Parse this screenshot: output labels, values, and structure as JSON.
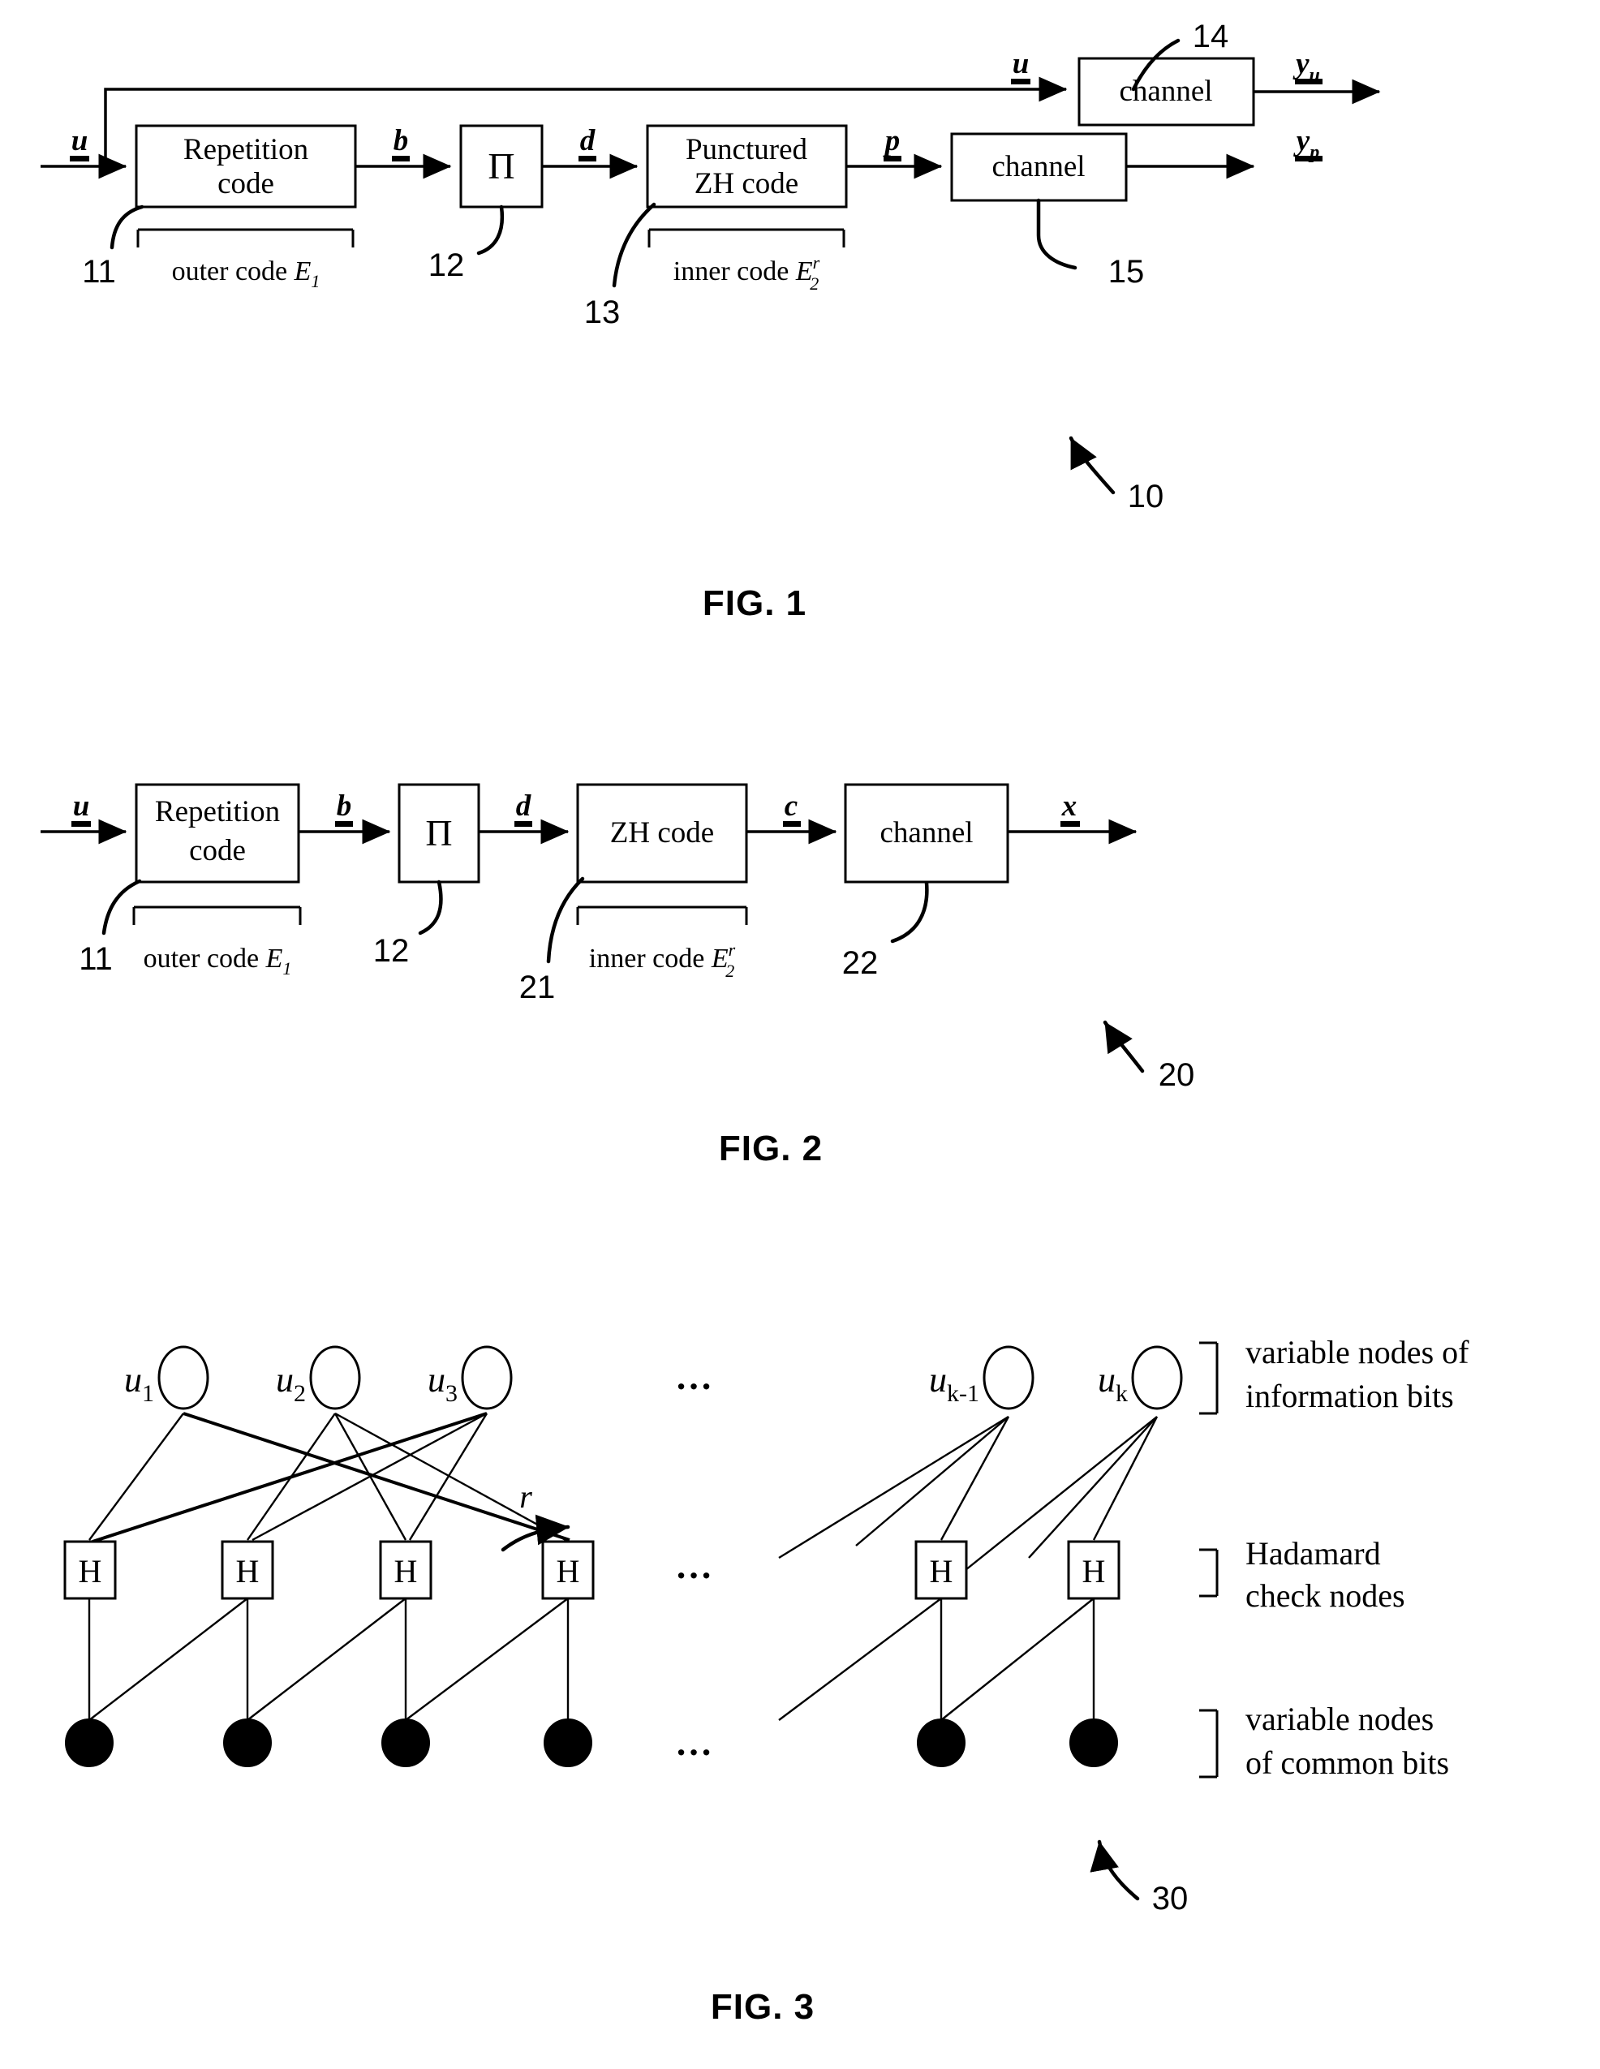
{
  "document": {
    "type": "patent-drawing-sheet",
    "background_color": "#ffffff",
    "ink_color": "#000000"
  },
  "figures": [
    {
      "id": "fig1",
      "caption": "FIG. 1",
      "system_ref": "10",
      "blocks": [
        {
          "key": "rep",
          "label_line1": "Repetition",
          "label_line2": "code",
          "ref": "11"
        },
        {
          "key": "interleaver",
          "label_line1": "Π",
          "label_line2": "",
          "ref": "12"
        },
        {
          "key": "zh",
          "label_line1": "Punctured",
          "label_line2": "ZH code",
          "ref": "13"
        },
        {
          "key": "chan_u",
          "label_line1": "channel",
          "label_line2": "",
          "ref": "14"
        },
        {
          "key": "chan_p",
          "label_line1": "channel",
          "label_line2": "",
          "ref": "15"
        }
      ],
      "signals": [
        {
          "key": "u_in",
          "base": "u",
          "sub": ""
        },
        {
          "key": "b",
          "base": "b",
          "sub": ""
        },
        {
          "key": "d",
          "base": "d",
          "sub": ""
        },
        {
          "key": "p",
          "base": "p",
          "sub": ""
        },
        {
          "key": "u_top",
          "base": "u",
          "sub": ""
        },
        {
          "key": "y_u",
          "base": "y",
          "sub": "u"
        },
        {
          "key": "y_p",
          "base": "y",
          "sub": "p"
        }
      ],
      "braces": [
        {
          "key": "outer",
          "text": "outer code ",
          "italic": "E",
          "sub": "1",
          "sup": ""
        },
        {
          "key": "inner",
          "text": "inner code ",
          "italic": "E",
          "sub": "2",
          "sup": "r"
        }
      ]
    },
    {
      "id": "fig2",
      "caption": "FIG. 2",
      "system_ref": "20",
      "blocks": [
        {
          "key": "rep",
          "label_line1": "Repetition",
          "label_line2": "code",
          "ref": "11"
        },
        {
          "key": "interleaver",
          "label_line1": "Π",
          "label_line2": "",
          "ref": "12"
        },
        {
          "key": "zh",
          "label_line1": "ZH code",
          "label_line2": "",
          "ref": "21"
        },
        {
          "key": "chan",
          "label_line1": "channel",
          "label_line2": "",
          "ref": "22"
        }
      ],
      "signals": [
        {
          "key": "u_in",
          "base": "u",
          "sub": ""
        },
        {
          "key": "b",
          "base": "b",
          "sub": ""
        },
        {
          "key": "d",
          "base": "d",
          "sub": ""
        },
        {
          "key": "c",
          "base": "c",
          "sub": ""
        },
        {
          "key": "x",
          "base": "x",
          "sub": ""
        }
      ],
      "braces": [
        {
          "key": "outer",
          "text": "outer code ",
          "italic": "E",
          "sub": "1",
          "sup": ""
        },
        {
          "key": "inner",
          "text": "inner code ",
          "italic": "E",
          "sub": "2",
          "sup": "r"
        }
      ]
    },
    {
      "id": "fig3",
      "caption": "FIG. 3",
      "system_ref": "30",
      "rate_label": "r",
      "ellipsis": "…",
      "information_nodes": [
        {
          "base": "u",
          "sub": "1"
        },
        {
          "base": "u",
          "sub": "2"
        },
        {
          "base": "u",
          "sub": "3"
        },
        {
          "base": "u",
          "sub": "k-1"
        },
        {
          "base": "u",
          "sub": "k"
        }
      ],
      "check_node_label": "H",
      "check_node_count_visible": 6,
      "common_node_count_visible": 6,
      "side_labels": [
        {
          "key": "info",
          "line1": "variable nodes of",
          "line2": "information bits"
        },
        {
          "key": "check",
          "line1": "Hadamard",
          "line2": "check nodes"
        },
        {
          "key": "common",
          "line1": "variable nodes",
          "line2": "of common bits"
        }
      ]
    }
  ]
}
